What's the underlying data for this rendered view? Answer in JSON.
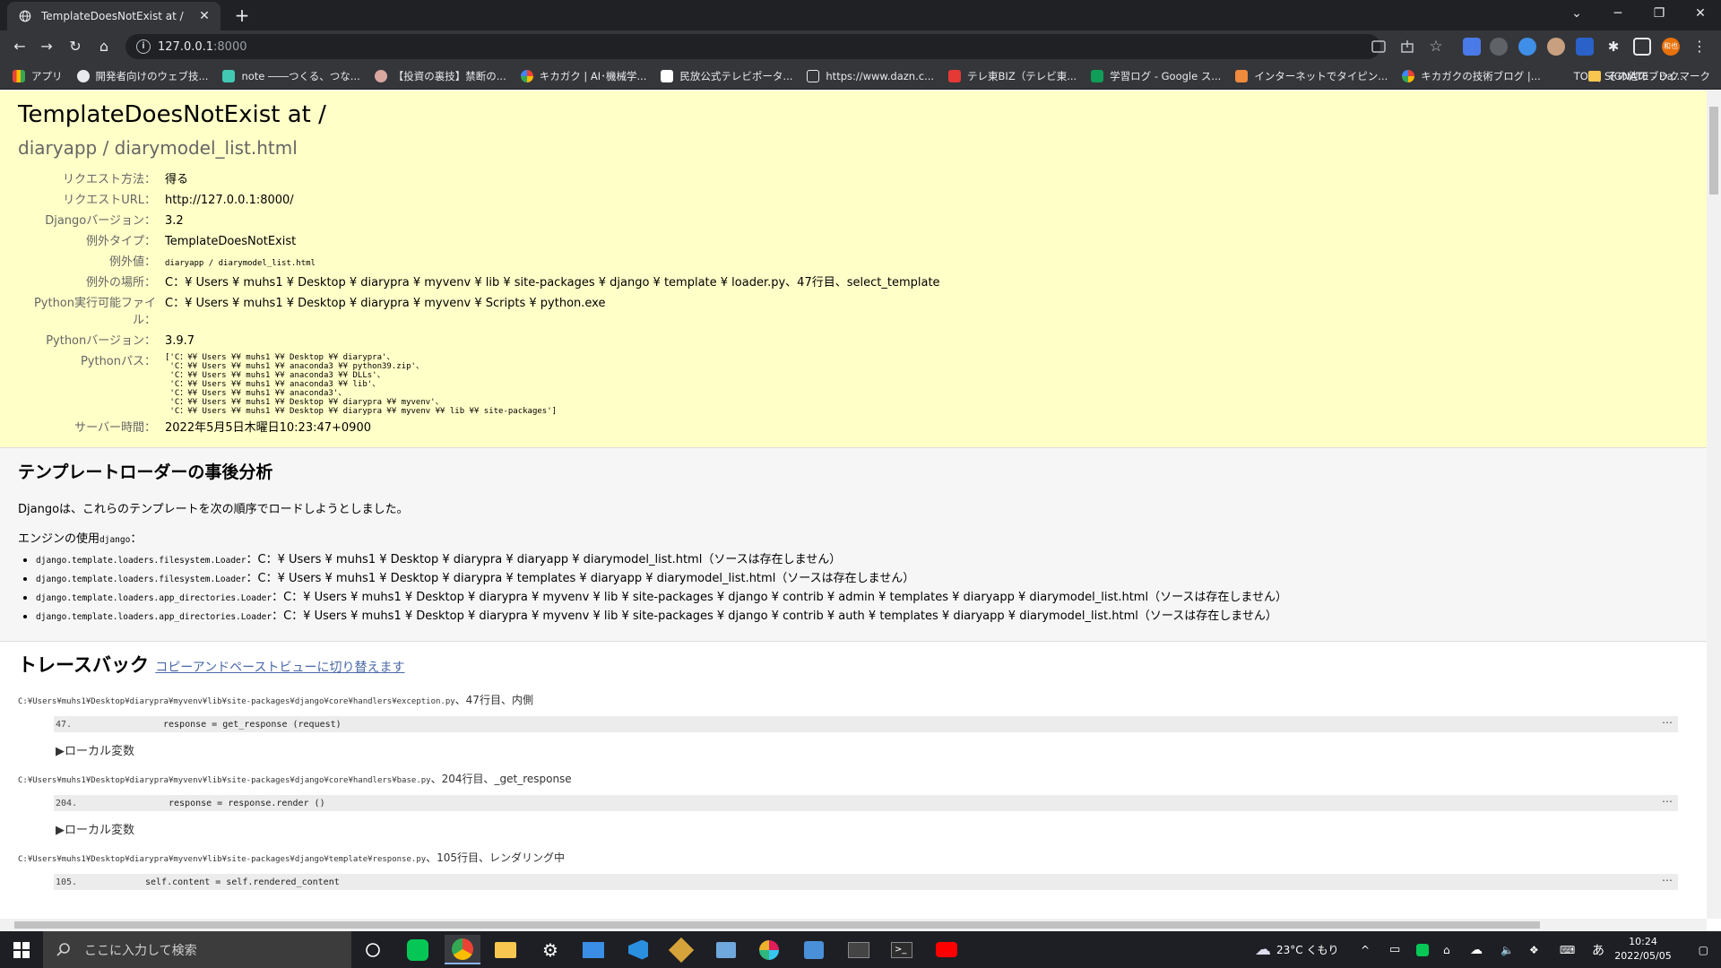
{
  "browser": {
    "tab_title": "TemplateDoesNotExist at /",
    "url_host": "127.0.0.1",
    "url_port": ":8000",
    "bookmarks": [
      "アプリ",
      "開発者向けのウェブ技...",
      "note ――つくる、つな...",
      "【投資の裏技】禁断の...",
      "キカガク | AI･機械学...",
      "民放公式テレビポータ...",
      "https://www.dazn.c...",
      "テレ東BIZ（テレビ東...",
      "学習ログ - Google ス...",
      "インターネットでタイピン...",
      "キカガクの技術ブログ |...",
      "TOP | SIGNATE - Da..."
    ],
    "other_bookmarks": "その他のブックマーク",
    "profile_label": "和也"
  },
  "colors": {
    "summary_bg": "#ffffc8",
    "section_bg": "#f6f6f6",
    "link": "#4a68a8"
  },
  "summary": {
    "title": "TemplateDoesNotExist at /",
    "subtitle": "diaryapp / diarymodel_list.html",
    "rows": [
      {
        "label": "リクエスト方法：",
        "value": "得る"
      },
      {
        "label": "リクエストURL：",
        "value": "http://127.0.0.1:8000/"
      },
      {
        "label": "Djangoバージョン：",
        "value": "3.2"
      },
      {
        "label": "例外タイプ：",
        "value": "TemplateDoesNotExist"
      },
      {
        "label": "例外値：",
        "value": "diaryapp / diarymodel_list.html"
      },
      {
        "label": "例外の場所：",
        "value": "C：¥ Users ¥ muhs1 ¥ Desktop ¥ diarypra ¥ myvenv ¥ lib ¥ site-packages ¥ django ¥ template ¥ loader.py、47行目、select_template"
      },
      {
        "label": "Python実行可能ファイル：",
        "value": "C：¥ Users ¥ muhs1 ¥ Desktop ¥ diarypra ¥ myvenv ¥ Scripts ¥ python.exe"
      },
      {
        "label": "Pythonバージョン：",
        "value": "3.9.7"
      },
      {
        "label": "Pythonパス：",
        "value": "['C：¥¥ Users ¥¥ muhs1 ¥¥ Desktop ¥¥ diarypra'、\n 'C：¥¥ Users ¥¥ muhs1 ¥¥ anaconda3 ¥¥ python39.zip'、\n 'C：¥¥ Users ¥¥ muhs1 ¥¥ anaconda3 ¥¥ DLLs'、\n 'C：¥¥ Users ¥¥ muhs1 ¥¥ anaconda3 ¥¥ lib'、\n 'C：¥¥ Users ¥¥ muhs1 ¥¥ anaconda3'、\n 'C：¥¥ Users ¥¥ muhs1 ¥¥ Desktop ¥¥ diarypra ¥¥ myvenv'、\n 'C：¥¥ Users ¥¥ muhs1 ¥¥ Desktop ¥¥ diarypra ¥¥ myvenv ¥¥ lib ¥¥ site-packages']"
      },
      {
        "label": "サーバー時間：",
        "value": "2022年5月5日木曜日10:23:47+0900"
      }
    ]
  },
  "postmortem": {
    "heading": "テンプレートローダーの事後分析",
    "intro": "Djangoは、これらのテンプレートを次の順序でロードしようとしました。",
    "engine_label": "エンジンの使用",
    "engine_name": "django",
    "engine_suffix": "：",
    "items": [
      {
        "loader": "django.template.loaders.filesystem.Loader",
        "path": "：C：¥ Users ¥ muhs1 ¥ Desktop ¥ diarypra ¥ diaryapp ¥ diarymodel_list.html（ソースは存在しません）"
      },
      {
        "loader": "django.template.loaders.filesystem.Loader",
        "path": "：C：¥ Users ¥ muhs1 ¥ Desktop ¥ diarypra ¥ templates ¥ diaryapp ¥ diarymodel_list.html（ソースは存在しません）"
      },
      {
        "loader": "django.template.loaders.app_directories.Loader",
        "path": "：C：¥ Users ¥ muhs1 ¥ Desktop ¥ diarypra ¥ myvenv ¥ lib ¥ site-packages ¥ django ¥ contrib ¥ admin ¥ templates ¥ diaryapp ¥ diarymodel_list.html（ソースは存在しません）"
      },
      {
        "loader": "django.template.loaders.app_directories.Loader",
        "path": "：C：¥ Users ¥ muhs1 ¥ Desktop ¥ diarypra ¥ myvenv ¥ lib ¥ site-packages ¥ django ¥ contrib ¥ auth ¥ templates ¥ diaryapp ¥ diarymodel_list.html（ソースは存在しません）"
      }
    ]
  },
  "traceback": {
    "heading": "トレースバック",
    "switch_link": "コピーアンドペーストビューに切り替えます",
    "local_vars_label": "▶ローカル変数",
    "frames": [
      {
        "path": "C:¥Users¥muhs1¥Desktop¥diarypra¥myvenv¥lib¥site-packages¥django¥core¥handlers¥exception.py",
        "suffix": "、47行目、内側",
        "lineno": "47.",
        "code": "response = get_response (request)"
      },
      {
        "path": "C:¥Users¥muhs1¥Desktop¥diarypra¥myvenv¥lib¥site-packages¥django¥core¥handlers¥base.py",
        "suffix": "、204行目、_get_response",
        "lineno": "204.",
        "code": "response = response.render ()"
      },
      {
        "path": "C:¥Users¥muhs1¥Desktop¥diarypra¥myvenv¥lib¥site-packages¥django¥template¥response.py",
        "suffix": "、105行目、レンダリング中",
        "lineno": "105.",
        "code": "self.content = self.rendered_content"
      }
    ]
  },
  "taskbar": {
    "search_placeholder": "ここに入力して検索",
    "weather": "23°C くもり",
    "time": "10:24",
    "date": "2022/05/05",
    "ime": "あ"
  }
}
